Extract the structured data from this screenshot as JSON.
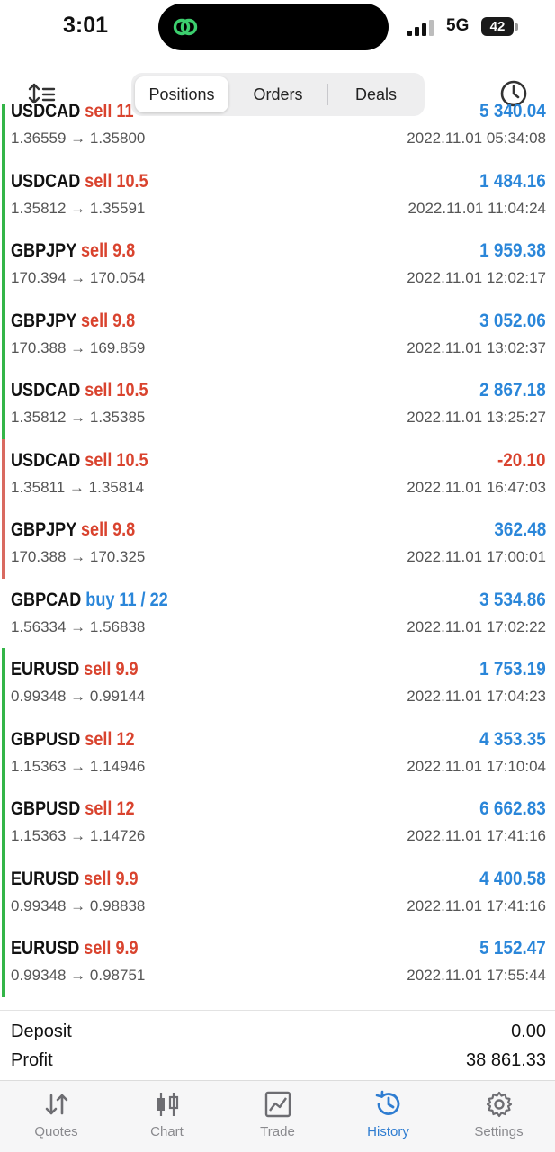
{
  "status": {
    "time": "3:01",
    "network": "5G",
    "battery": "42"
  },
  "header": {
    "tabs": [
      "Positions",
      "Orders",
      "Deals"
    ],
    "active_tab": "Positions"
  },
  "colors": {
    "sell": "#d9432e",
    "buy": "#2a86d9",
    "profit_pos": "#2a86d9",
    "profit_neg": "#d9432e",
    "bar_green": "#34b548",
    "bar_red": "#d96a60",
    "active_tab": "#2f7dd1"
  },
  "deals": [
    {
      "symbol": "USDCAD",
      "type": "sell 11",
      "side": "sell",
      "prices": "1.36559 → 1.35800",
      "profit": "5 340.04",
      "time": "2022.11.01 05:34:08",
      "bar": "green",
      "negative": false
    },
    {
      "symbol": "USDCAD",
      "type": "sell 10.5",
      "side": "sell",
      "prices": "1.35812 → 1.35591",
      "profit": "1 484.16",
      "time": "2022.11.01 11:04:24",
      "bar": "green",
      "negative": false
    },
    {
      "symbol": "GBPJPY",
      "type": "sell 9.8",
      "side": "sell",
      "prices": "170.394 → 170.054",
      "profit": "1 959.38",
      "time": "2022.11.01 12:02:17",
      "bar": "green",
      "negative": false
    },
    {
      "symbol": "GBPJPY",
      "type": "sell 9.8",
      "side": "sell",
      "prices": "170.388 → 169.859",
      "profit": "3 052.06",
      "time": "2022.11.01 13:02:37",
      "bar": "green",
      "negative": false
    },
    {
      "symbol": "USDCAD",
      "type": "sell 10.5",
      "side": "sell",
      "prices": "1.35812 → 1.35385",
      "profit": "2 867.18",
      "time": "2022.11.01 13:25:27",
      "bar": "green",
      "negative": false
    },
    {
      "symbol": "USDCAD",
      "type": "sell 10.5",
      "side": "sell",
      "prices": "1.35811 → 1.35814",
      "profit": "-20.10",
      "time": "2022.11.01 16:47:03",
      "bar": "red",
      "negative": true
    },
    {
      "symbol": "GBPJPY",
      "type": "sell 9.8",
      "side": "sell",
      "prices": "170.388 → 170.325",
      "profit": "362.48",
      "time": "2022.11.01 17:00:01",
      "bar": "red",
      "negative": false
    },
    {
      "symbol": "GBPCAD",
      "type": "buy 11 / 22",
      "side": "buy",
      "prices": "1.56334 → 1.56838",
      "profit": "3 534.86",
      "time": "2022.11.01 17:02:22",
      "bar": "none",
      "negative": false
    },
    {
      "symbol": "EURUSD",
      "type": "sell 9.9",
      "side": "sell",
      "prices": "0.99348 → 0.99144",
      "profit": "1 753.19",
      "time": "2022.11.01 17:04:23",
      "bar": "green",
      "negative": false
    },
    {
      "symbol": "GBPUSD",
      "type": "sell 12",
      "side": "sell",
      "prices": "1.15363 → 1.14946",
      "profit": "4 353.35",
      "time": "2022.11.01 17:10:04",
      "bar": "green",
      "negative": false
    },
    {
      "symbol": "GBPUSD",
      "type": "sell 12",
      "side": "sell",
      "prices": "1.15363 → 1.14726",
      "profit": "6 662.83",
      "time": "2022.11.01 17:41:16",
      "bar": "green",
      "negative": false
    },
    {
      "symbol": "EURUSD",
      "type": "sell 9.9",
      "side": "sell",
      "prices": "0.99348 → 0.98838",
      "profit": "4 400.58",
      "time": "2022.11.01 17:41:16",
      "bar": "green",
      "negative": false
    },
    {
      "symbol": "EURUSD",
      "type": "sell 9.9",
      "side": "sell",
      "prices": "0.99348 → 0.98751",
      "profit": "5 152.47",
      "time": "2022.11.01 17:55:44",
      "bar": "green",
      "negative": false
    }
  ],
  "summary": {
    "deposit_label": "Deposit",
    "deposit_value": "0.00",
    "profit_label": "Profit",
    "profit_value": "38 861.33"
  },
  "tabbar": [
    {
      "label": "Quotes",
      "icon": "quotes-icon",
      "active": false
    },
    {
      "label": "Chart",
      "icon": "chart-icon",
      "active": false
    },
    {
      "label": "Trade",
      "icon": "trade-icon",
      "active": false
    },
    {
      "label": "History",
      "icon": "history-icon",
      "active": true
    },
    {
      "label": "Settings",
      "icon": "settings-icon",
      "active": false
    }
  ]
}
